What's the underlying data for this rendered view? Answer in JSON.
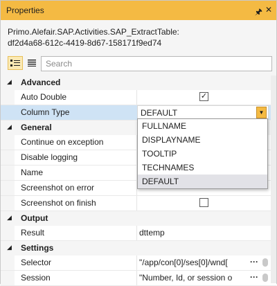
{
  "panel": {
    "title": "Properties",
    "pin_icon": "pin-icon",
    "close_icon": "close-icon",
    "subtitle_line1": "Primo.Alefair.SAP.Activities.SAP_ExtractTable:",
    "subtitle_line2": "df2d4a68-612c-4419-8d67-158171f9ed74",
    "accent_color": "#f4ba43"
  },
  "toolbar": {
    "categorized_icon": "categorized-view-icon",
    "alphabetical_icon": "alphabetical-view-icon",
    "search_placeholder": "Search"
  },
  "grid": {
    "advanced": {
      "label": "Advanced",
      "auto_double": {
        "name": "Auto Double",
        "checked": true
      },
      "column_type": {
        "name": "Column Type",
        "value": "DEFAULT"
      }
    },
    "general": {
      "label": "General",
      "continue_on_exception": {
        "name": "Continue on exception"
      },
      "disable_logging": {
        "name": "Disable logging"
      },
      "name": {
        "name": "Name"
      },
      "screenshot_on_error": {
        "name": "Screenshot on error"
      },
      "screenshot_on_finish": {
        "name": "Screenshot on finish",
        "checked": false
      }
    },
    "output": {
      "label": "Output",
      "result": {
        "name": "Result",
        "value": "dttemp"
      }
    },
    "settings": {
      "label": "Settings",
      "selector": {
        "name": "Selector",
        "value": "\"/app/con[0]/ses[0]/wnd[",
        "more": "···"
      },
      "session": {
        "name": "Session",
        "value": "\"Number, Id, or session o",
        "more": "···"
      }
    }
  },
  "dropdown": {
    "options": [
      "FULLNAME",
      "DISPLAYNAME",
      "TOOLTIP",
      "TECHNAMES",
      "DEFAULT"
    ],
    "selected": "DEFAULT"
  }
}
